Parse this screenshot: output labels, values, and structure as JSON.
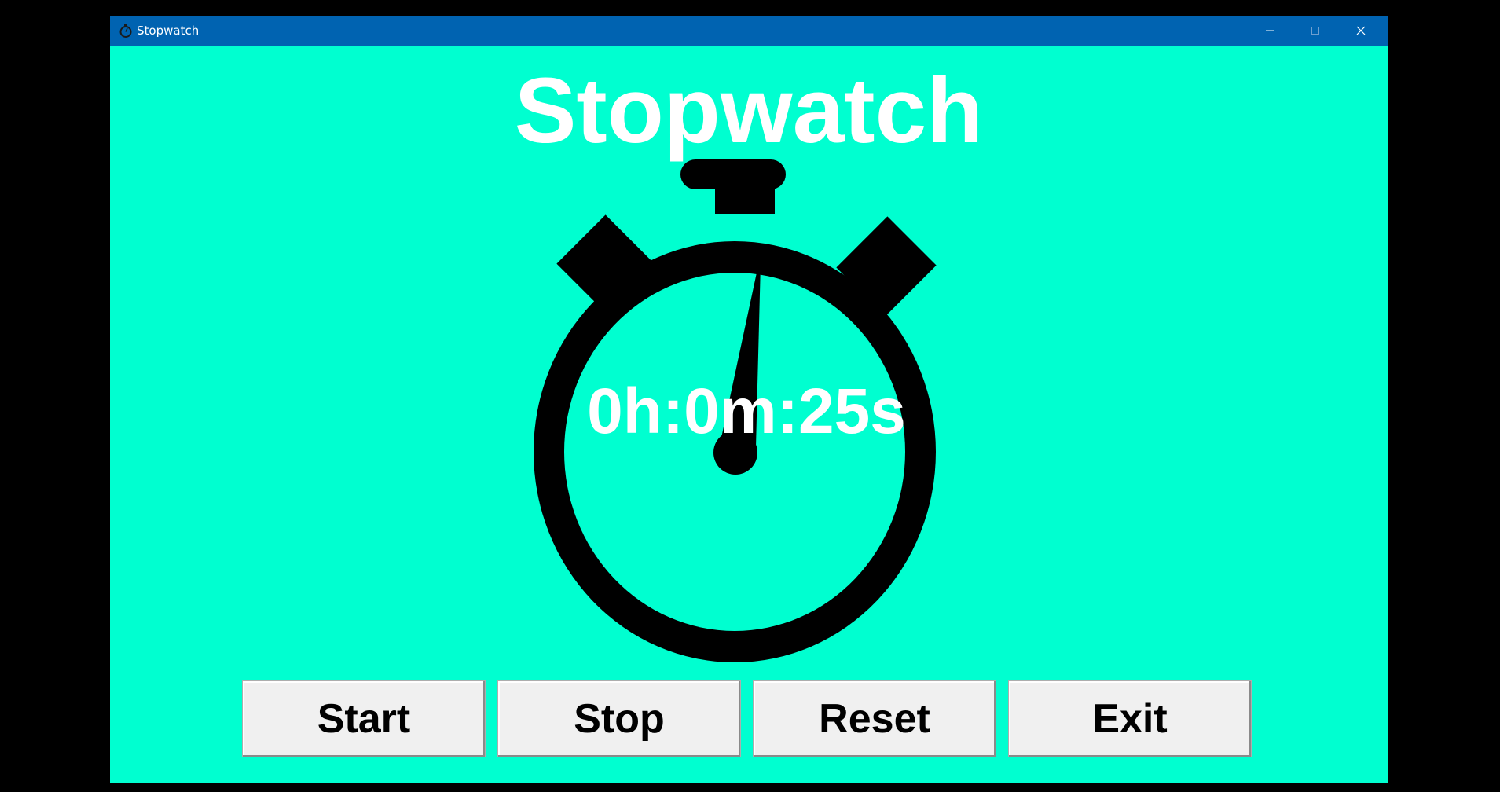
{
  "window": {
    "title": "Stopwatch",
    "app_icon": "stopwatch-icon",
    "controls": {
      "minimize_icon": "minimize-icon",
      "maximize_icon": "maximize-icon",
      "close_icon": "close-icon"
    }
  },
  "main": {
    "heading": "Stopwatch",
    "time": "0h:0m:25s",
    "dial_icon": "stopwatch-dial-icon"
  },
  "buttons": {
    "start": "Start",
    "stop": "Stop",
    "reset": "Reset",
    "exit": "Exit"
  },
  "colors": {
    "titlebar": "#0063B1",
    "background": "#00FFD0",
    "heading_text": "#FFFFFF",
    "dial": "#000000",
    "button_face": "#F0F0F0"
  }
}
